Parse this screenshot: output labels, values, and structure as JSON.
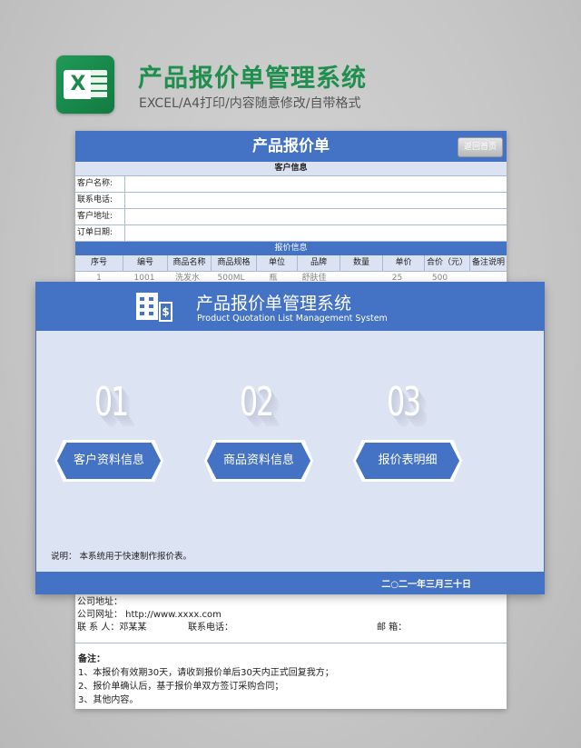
{
  "header": {
    "title": "产品报价单管理系统",
    "subtitle": "EXCEL/A4打印/内容随意修改/自带格式"
  },
  "sheet": {
    "title": "产品报价单",
    "back_button": "返回首页",
    "customer_section": "客户信息",
    "customer_fields": [
      "客户名称:",
      "联系电话:",
      "客户地址:",
      "订单日期:"
    ],
    "quote_section": "报价信息",
    "columns": [
      "序号",
      "编号",
      "商品名称",
      "商品规格",
      "单位",
      "品牌",
      "数量",
      "单价",
      "合价（元）",
      "备注说明"
    ],
    "first_row": [
      "1",
      "1001",
      "洗发水",
      "500ML",
      "瓶",
      "舒肤佳",
      "",
      "25",
      "500",
      ""
    ],
    "company_address": "公司地址：",
    "company_site": "公司网址：  http://www.xxxx.com",
    "contact_label": "联  系  人：邓某某",
    "contact_phone": "联系电话：",
    "mailbox": "邮      箱：",
    "notes_title": "备注：",
    "notes": [
      "1、本报价有效期30天，请收到报价单后30天内正式回复我方；",
      "2、报价单确认后，基于报价单双方签订采购合同；",
      "3、其他内容。"
    ]
  },
  "panel": {
    "title": "产品报价单管理系统",
    "subtitle": "Product Quotation List Management System",
    "items": [
      {
        "number": "01",
        "label": "客户资料信息"
      },
      {
        "number": "02",
        "label": "商品资料信息"
      },
      {
        "number": "03",
        "label": "报价表明细"
      }
    ],
    "note": "说明：  本系统用于快速制作报价表。",
    "date": "二○二一年三月三十日"
  },
  "colors": {
    "accent": "#4472c4",
    "excel_green": "#1f8f4e",
    "panel_bg": "#dce3f2"
  },
  "icons": [
    "excel-logo-icon",
    "building-icon",
    "dollar-doc-icon"
  ]
}
